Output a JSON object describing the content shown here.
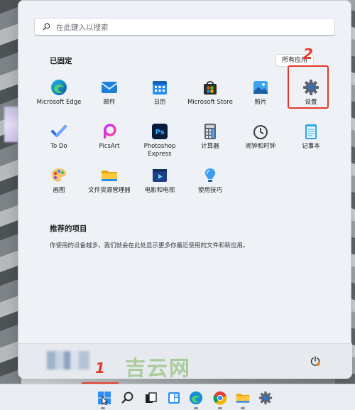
{
  "search": {
    "placeholder": "在此键入以搜索"
  },
  "pinned": {
    "title": "已固定",
    "all_apps_label": "所有应用",
    "apps": [
      {
        "label": "Microsoft Edge",
        "icon": "edge-icon"
      },
      {
        "label": "邮件",
        "icon": "mail-icon"
      },
      {
        "label": "日历",
        "icon": "calendar-icon"
      },
      {
        "label": "Microsoft Store",
        "icon": "store-icon"
      },
      {
        "label": "照片",
        "icon": "photos-icon"
      },
      {
        "label": "设置",
        "icon": "settings-gear-icon"
      },
      {
        "label": "To Do",
        "icon": "todo-icon"
      },
      {
        "label": "PicsArt",
        "icon": "picsart-icon"
      },
      {
        "label": "Photoshop Express",
        "icon": "photoshop-express-icon"
      },
      {
        "label": "计算器",
        "icon": "calculator-icon"
      },
      {
        "label": "闹钟和时钟",
        "icon": "clock-icon"
      },
      {
        "label": "记事本",
        "icon": "notepad-icon"
      },
      {
        "label": "画图",
        "icon": "paint-icon"
      },
      {
        "label": "文件资源管理器",
        "icon": "file-explorer-icon"
      },
      {
        "label": "电影和电视",
        "icon": "movies-tv-icon"
      },
      {
        "label": "使用技巧",
        "icon": "tips-icon"
      }
    ]
  },
  "recommended": {
    "title": "推荐的项目",
    "description": "你使用的设备越多，我们就会在此处显示更多你最近使用的文件和新应用。"
  },
  "annotations": {
    "step1": "1",
    "step2": "2",
    "color": "#e33a2b"
  },
  "watermark": "吉云网",
  "taskbar": {
    "icons": [
      "start-windows-icon",
      "search-icon",
      "task-view-icon",
      "widgets-icon",
      "edge-icon",
      "chrome-icon",
      "file-explorer-icon",
      "settings-gear-icon"
    ]
  }
}
